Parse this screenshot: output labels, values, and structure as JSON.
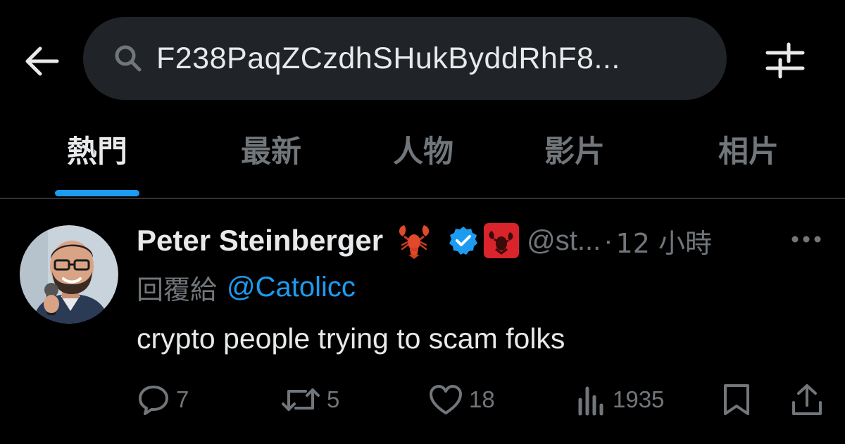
{
  "search": {
    "query": "F238PaqZCzdhSHukByddRhF8..."
  },
  "tabs": [
    {
      "label": "熱門",
      "active": true
    },
    {
      "label": "最新",
      "active": false
    },
    {
      "label": "人物",
      "active": false
    },
    {
      "label": "影片",
      "active": false
    },
    {
      "label": "相片",
      "active": false
    }
  ],
  "tweet": {
    "display_name": "Peter Steinberger",
    "handle": "@st...",
    "separator": "·",
    "time": "12 小時",
    "reply_prefix": "回覆給",
    "reply_to": "@Catolicc",
    "text": "crypto people trying to scam folks",
    "stats": {
      "replies": "7",
      "reposts": "5",
      "likes": "18",
      "views": "1935"
    }
  },
  "icons": {
    "back": "back-arrow-icon",
    "search": "search-icon",
    "filter": "filter-sliders-icon",
    "lobster": "lobster-emoji-icon",
    "verified": "verified-badge-icon",
    "affiliate": "affiliate-lobster-badge-icon",
    "more": "more-dots-icon",
    "reply": "reply-bubble-icon",
    "repost": "repost-arrows-icon",
    "like": "heart-icon",
    "views": "views-chart-icon",
    "bookmark": "bookmark-icon",
    "share": "share-upload-icon"
  },
  "colors": {
    "background": "#000000",
    "text_primary": "#e7e9ea",
    "text_secondary": "#71767b",
    "accent": "#1d9bf0",
    "search_bg": "#202327",
    "divider": "#2f3336"
  }
}
